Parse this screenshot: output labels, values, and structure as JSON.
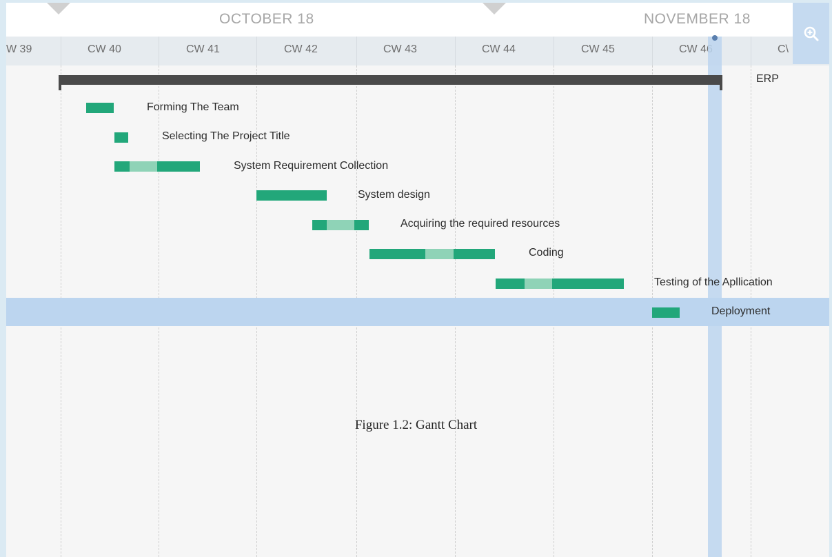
{
  "timeline": {
    "months": [
      "OCTOBER 18",
      "NOVEMBER 18"
    ],
    "weeks": [
      "W 39",
      "CW 40",
      "CW 41",
      "CW 42",
      "CW 43",
      "CW 44",
      "CW 45",
      "CW 46",
      "C\\"
    ]
  },
  "project": {
    "name": "ERP"
  },
  "tasks": [
    {
      "label": "Forming The Team"
    },
    {
      "label": "Selecting The Project Title"
    },
    {
      "label": "System Requirement Collection"
    },
    {
      "label": "System design"
    },
    {
      "label": "Acquiring the required resources"
    },
    {
      "label": "Coding"
    },
    {
      "label": "Testing of the Apllication"
    },
    {
      "label": "Deployment"
    }
  ],
  "toolbar": {
    "zoom_icon": "zoom-in-icon"
  },
  "caption": "Figure 1.2: Gantt Chart",
  "colors": {
    "bar": "#22a77a",
    "bar_light": "#8fd3b7",
    "highlight": "#bcd5ef",
    "summary": "#4a4a4a"
  }
}
